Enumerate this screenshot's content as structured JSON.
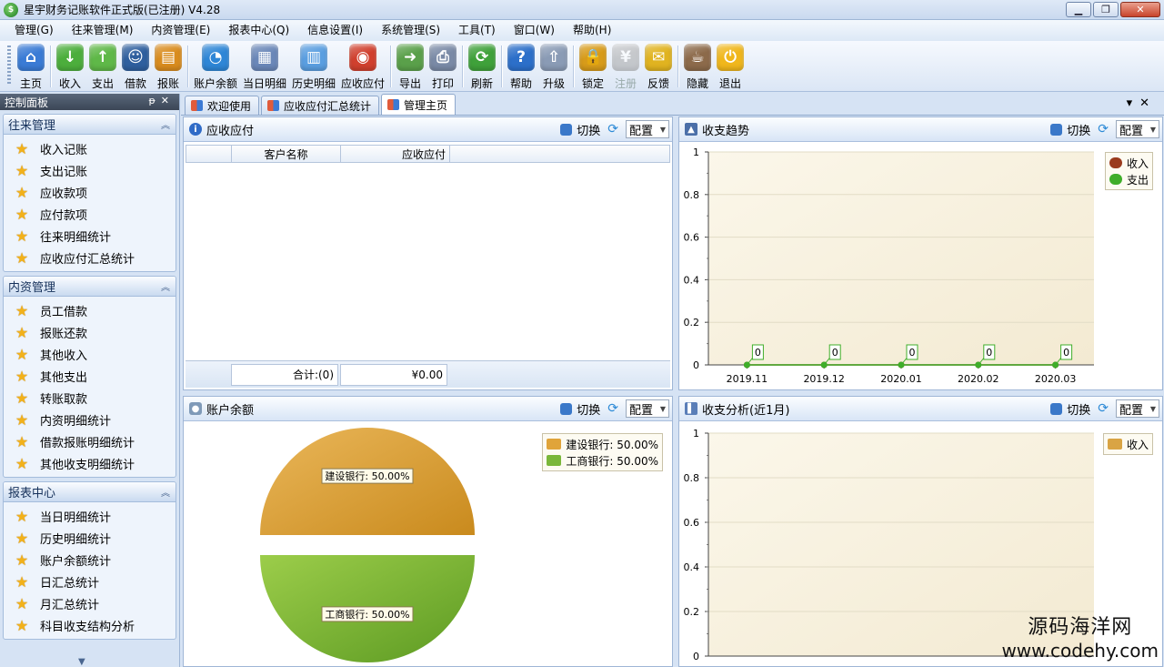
{
  "window": {
    "title": "星宇财务记账软件正式版(已注册) V4.28",
    "app_icon_text": "$"
  },
  "menu": [
    "管理(G)",
    "往来管理(M)",
    "内资管理(E)",
    "报表中心(Q)",
    "信息设置(I)",
    "系统管理(S)",
    "工具(T)",
    "窗口(W)",
    "帮助(H)"
  ],
  "toolbar": {
    "items": [
      {
        "label": "主页",
        "icon": "house-icon",
        "color": "#3a7bd5",
        "glyph": "⌂"
      },
      {
        "sep": true
      },
      {
        "label": "收入",
        "icon": "arrow-down-icon",
        "color": "#4cae3c",
        "glyph": "↓"
      },
      {
        "label": "支出",
        "icon": "arrow-up-icon",
        "color": "#5fb848",
        "glyph": "↑"
      },
      {
        "label": "借款",
        "icon": "person-icon",
        "color": "#2f5f9e",
        "glyph": "☺"
      },
      {
        "label": "报账",
        "icon": "books-icon",
        "color": "#d98c1e",
        "glyph": "▤"
      },
      {
        "sep": true
      },
      {
        "label": "账户余额",
        "icon": "pie-chart-icon",
        "color": "#2e86d6",
        "glyph": "◔"
      },
      {
        "label": "当日明细",
        "icon": "calendar-icon",
        "color": "#6a87b8",
        "glyph": "▦"
      },
      {
        "label": "历史明细",
        "icon": "document-icon",
        "color": "#5a9ee0",
        "glyph": "▥"
      },
      {
        "label": "应收应付",
        "icon": "gauge-icon",
        "color": "#d0402e",
        "glyph": "◉"
      },
      {
        "sep": true
      },
      {
        "label": "导出",
        "icon": "export-icon",
        "color": "#5aa04a",
        "glyph": "➜"
      },
      {
        "label": "打印",
        "icon": "printer-icon",
        "color": "#7a8aa6",
        "glyph": "⎙"
      },
      {
        "sep": true
      },
      {
        "label": "刷新",
        "icon": "refresh-icon",
        "color": "#3fa13a",
        "glyph": "⟳"
      },
      {
        "sep": true
      },
      {
        "label": "帮助",
        "icon": "help-icon",
        "color": "#2c6fc9",
        "glyph": "?"
      },
      {
        "label": "升级",
        "icon": "upgrade-icon",
        "color": "#8a9bb5",
        "glyph": "⇧"
      },
      {
        "sep": true
      },
      {
        "label": "锁定",
        "icon": "lock-icon",
        "color": "#d79b1a",
        "glyph": "🔒"
      },
      {
        "label": "注册",
        "icon": "yen-icon",
        "color": "#9aa6b8",
        "glyph": "¥",
        "disabled": true
      },
      {
        "label": "反馈",
        "icon": "feedback-icon",
        "color": "#e0b320",
        "glyph": "✉"
      },
      {
        "sep": true
      },
      {
        "label": "隐藏",
        "icon": "coffee-icon",
        "color": "#8c6a4a",
        "glyph": "☕"
      },
      {
        "label": "退出",
        "icon": "power-icon",
        "color": "#f0b71c",
        "glyph": "⏻"
      }
    ]
  },
  "left_panel": {
    "title": "控制面板",
    "groups": [
      {
        "title": "往来管理",
        "items": [
          "收入记账",
          "支出记账",
          "应收款项",
          "应付款项",
          "往来明细统计",
          "应收应付汇总统计"
        ]
      },
      {
        "title": "内资管理",
        "items": [
          "员工借款",
          "报账还款",
          "其他收入",
          "其他支出",
          "转账取款",
          "内资明细统计",
          "借款报账明细统计",
          "其他收支明细统计"
        ]
      },
      {
        "title": "报表中心",
        "items": [
          "当日明细统计",
          "历史明细统计",
          "账户余额统计",
          "日汇总统计",
          "月汇总统计",
          "科目收支结构分析"
        ]
      }
    ]
  },
  "tabs": [
    "欢迎使用",
    "应收应付汇总统计",
    "管理主页"
  ],
  "active_tab": 2,
  "panel_common": {
    "switch_label": "切换",
    "config_label": "配置"
  },
  "panels": {
    "receivable": {
      "title": "应收应付",
      "columns": [
        "客户名称",
        "应收应付"
      ],
      "footer_count": "合计:(0)",
      "footer_sum": "¥0.00"
    },
    "trend": {
      "title": "收支趋势"
    },
    "balance": {
      "title": "账户余额"
    },
    "analysis": {
      "title": "收支分析(近1月)"
    }
  },
  "chart_data": [
    {
      "type": "line",
      "categories": [
        "2019.11",
        "2019.12",
        "2020.01",
        "2020.02",
        "2020.03"
      ],
      "series": [
        {
          "name": "收入",
          "values": [
            0,
            0,
            0,
            0,
            0
          ],
          "color": "#9a3b1e"
        },
        {
          "name": "支出",
          "values": [
            0,
            0,
            0,
            0,
            0
          ],
          "color": "#3fae2a"
        }
      ],
      "data_labels": [
        "0",
        "0",
        "0",
        "0",
        "0"
      ],
      "ylim": [
        0,
        1
      ],
      "yticks": [
        "0",
        "0.2",
        "0.4",
        "0.6",
        "0.8",
        "1"
      ],
      "grid": true,
      "legend": "top-right"
    },
    {
      "type": "pie",
      "series": [
        {
          "name": "建设银行",
          "value": 50.0,
          "label": "建设银行: 50.00%",
          "color": "#e0a43a"
        },
        {
          "name": "工商银行",
          "value": 50.0,
          "label": "工商银行: 50.00%",
          "color": "#7ab73a"
        }
      ],
      "legend_labels": [
        "建设银行: 50.00%",
        "工商银行: 50.00%"
      ],
      "legend": "top-right"
    },
    {
      "type": "bar",
      "series": [
        {
          "name": "收入",
          "values": [],
          "color": "#d9a444"
        }
      ],
      "ylim": [
        0,
        1
      ],
      "yticks": [
        "0",
        "0.2",
        "0.4",
        "0.6",
        "0.8",
        "1"
      ],
      "grid": true,
      "legend": "top-right"
    }
  ],
  "watermark": {
    "line1": "源码海洋网",
    "line2": "www.codehy.com"
  }
}
